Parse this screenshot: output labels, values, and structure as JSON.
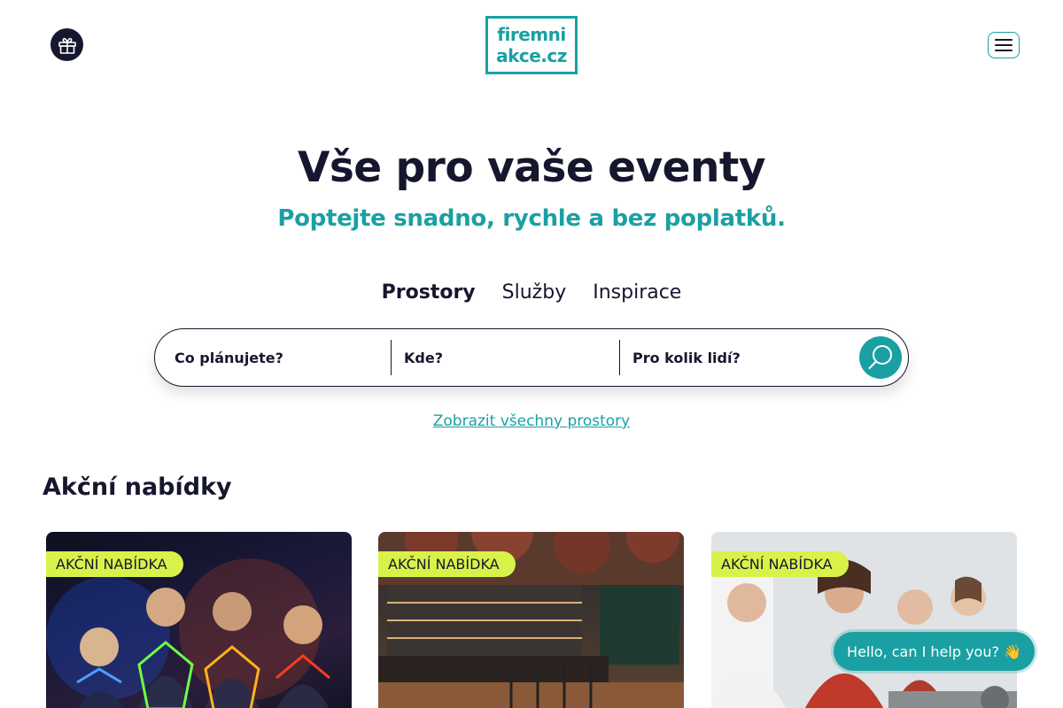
{
  "header": {
    "logo_line1": "firemni",
    "logo_line2": "akce.cz"
  },
  "hero": {
    "title": "Vše pro vaše eventy",
    "subtitle": "Poptejte snadno, rychle a bez poplatků."
  },
  "tabs": [
    {
      "label": "Prostory",
      "active": true
    },
    {
      "label": "Služby",
      "active": false
    },
    {
      "label": "Inspirace",
      "active": false
    }
  ],
  "search": {
    "what_label": "Co plánujete?",
    "where_label": "Kde?",
    "people_label": "Pro kolik lidí?"
  },
  "show_all_link": "Zobrazit všechny prostory",
  "offers": {
    "title": "Akční nabídky",
    "cards": [
      {
        "badge": "AKČNÍ NABÍDKA"
      },
      {
        "badge": "AKČNÍ NABÍDKA"
      },
      {
        "badge": "AKČNÍ NABÍDKA"
      }
    ]
  },
  "chat": {
    "label": "Hello, can I help you? 👋"
  },
  "colors": {
    "accent": "#1aa0a3",
    "dark": "#16162e",
    "badge": "#d9f24a"
  },
  "icons": {
    "gift": "gift-icon",
    "menu": "hamburger-menu-icon",
    "search": "search-icon"
  }
}
